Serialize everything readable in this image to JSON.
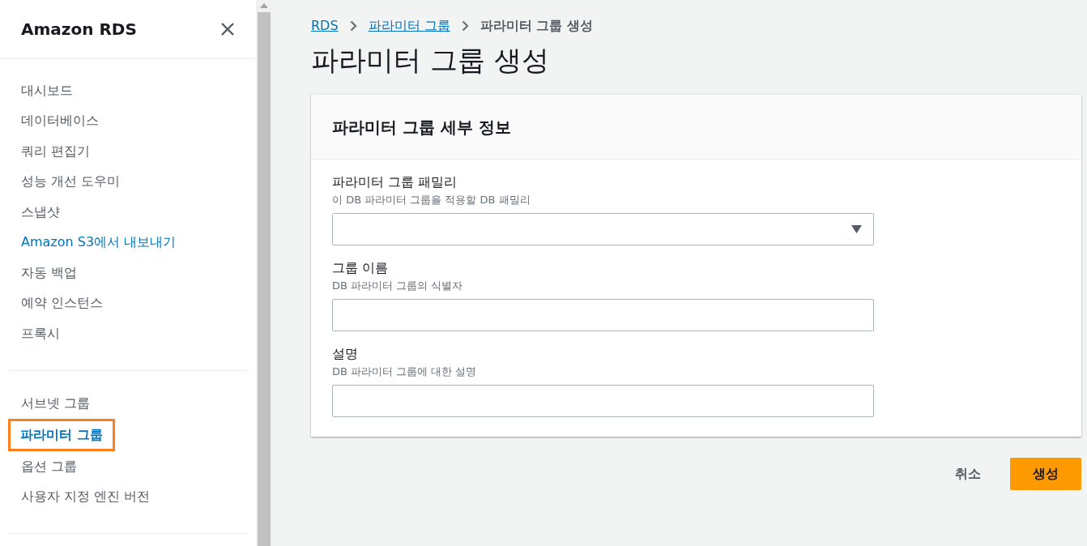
{
  "sidebar": {
    "title": "Amazon RDS",
    "sections": [
      {
        "items": [
          {
            "label": "대시보드",
            "kind": "plain",
            "selected": false
          },
          {
            "label": "데이터베이스",
            "kind": "plain",
            "selected": false
          },
          {
            "label": "쿼리 편집기",
            "kind": "plain",
            "selected": false
          },
          {
            "label": "성능 개선 도우미",
            "kind": "plain",
            "selected": false
          },
          {
            "label": "스냅샷",
            "kind": "plain",
            "selected": false
          },
          {
            "label": "Amazon S3에서 내보내기",
            "kind": "link",
            "selected": false
          },
          {
            "label": "자동 백업",
            "kind": "plain",
            "selected": false
          },
          {
            "label": "예약 인스턴스",
            "kind": "plain",
            "selected": false
          },
          {
            "label": "프록시",
            "kind": "plain",
            "selected": false
          }
        ]
      },
      {
        "items": [
          {
            "label": "서브넷 그룹",
            "kind": "plain",
            "selected": false
          },
          {
            "label": "파라미터 그룹",
            "kind": "link",
            "selected": true
          },
          {
            "label": "옵션 그룹",
            "kind": "plain",
            "selected": false
          },
          {
            "label": "사용자 지정 엔진 버전",
            "kind": "plain",
            "selected": false
          }
        ]
      }
    ]
  },
  "breadcrumb": [
    {
      "label": "RDS",
      "kind": "link"
    },
    {
      "label": "파라미터 그룹",
      "kind": "link"
    },
    {
      "label": "파라미터 그룹 생성",
      "kind": "current"
    }
  ],
  "page_title": "파라미터 그룹 생성",
  "panel": {
    "title": "파라미터 그룹 세부 정보",
    "fields": [
      {
        "label": "파라미터 그룹 패밀리",
        "hint": "이 DB 파라미터 그룹을 적용할 DB 패밀리",
        "kind": "select"
      },
      {
        "label": "그룹 이름",
        "hint": "DB 파라미터 그룹의 식별자",
        "kind": "text"
      },
      {
        "label": "설명",
        "hint": "DB 파라미터 그룹에 대한 설명",
        "kind": "text"
      }
    ]
  },
  "buttons": [
    {
      "label": "취소",
      "kind": "plain"
    },
    {
      "label": "생성",
      "kind": "primary"
    }
  ]
}
